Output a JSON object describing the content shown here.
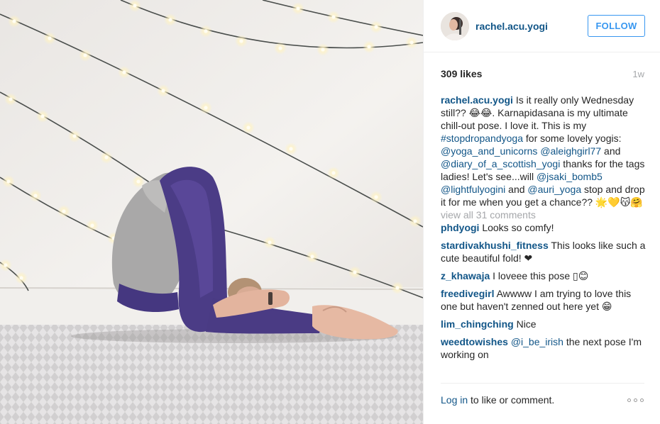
{
  "post": {
    "image_alt": "Woman in Karnapidasana yoga pose in front of a wall with string lights"
  },
  "header": {
    "username": "rachel.acu.yogi",
    "follow_label": "FOLLOW"
  },
  "stats": {
    "likes": "309 likes",
    "time": "1w"
  },
  "caption": {
    "author": "rachel.acu.yogi",
    "p1": " Is it really only Wednesday still?? 😂😂. Karnapidasana is my ultimate chill-out pose. I love it. This is my ",
    "hashtag": "#stopdropandyoga",
    "p2": " for some lovely yogis: ",
    "m1": "@yoga_and_unicorns",
    "p3": " ",
    "m2": "@aleighgirl77",
    "p4": " and ",
    "m3": "@diary_of_a_scottish_yogi",
    "p5": " thanks for the tags ladies! Let's see...will ",
    "m4": "@jsaki_bomb5",
    "p6": " ",
    "m5": "@lightfulyogini",
    "p7": " and ",
    "m6": "@auri_yoga",
    "p8": " stop and drop it for me when you get a chance?? 🌟💛😽🤗"
  },
  "view_all": "view all 31 comments",
  "comments": [
    {
      "user": "phdyogi",
      "text": " Looks so comfy!"
    },
    {
      "user": "stardivakhushi_fitness",
      "text": " This looks like such a cute beautiful fold! ❤"
    },
    {
      "user": "z_khawaja",
      "text": " I loveee this pose ▯😊"
    },
    {
      "user": "freedivegirl",
      "text": " Awwww I am trying to love this one but haven't zenned out here yet 😁"
    },
    {
      "user": "lim_chingching",
      "text": " Nice"
    },
    {
      "user": "weedtowishes",
      "mention": "@i_be_irish",
      "text": " the next pose I'm working on"
    }
  ],
  "footer": {
    "login_label": "Log in",
    "rest": " to like or comment."
  },
  "icons": {
    "more": "ellipsis-icon",
    "avatar": "avatar"
  },
  "colors": {
    "link": "#125688",
    "follow": "#3897f0",
    "muted": "#a5a7aa"
  }
}
